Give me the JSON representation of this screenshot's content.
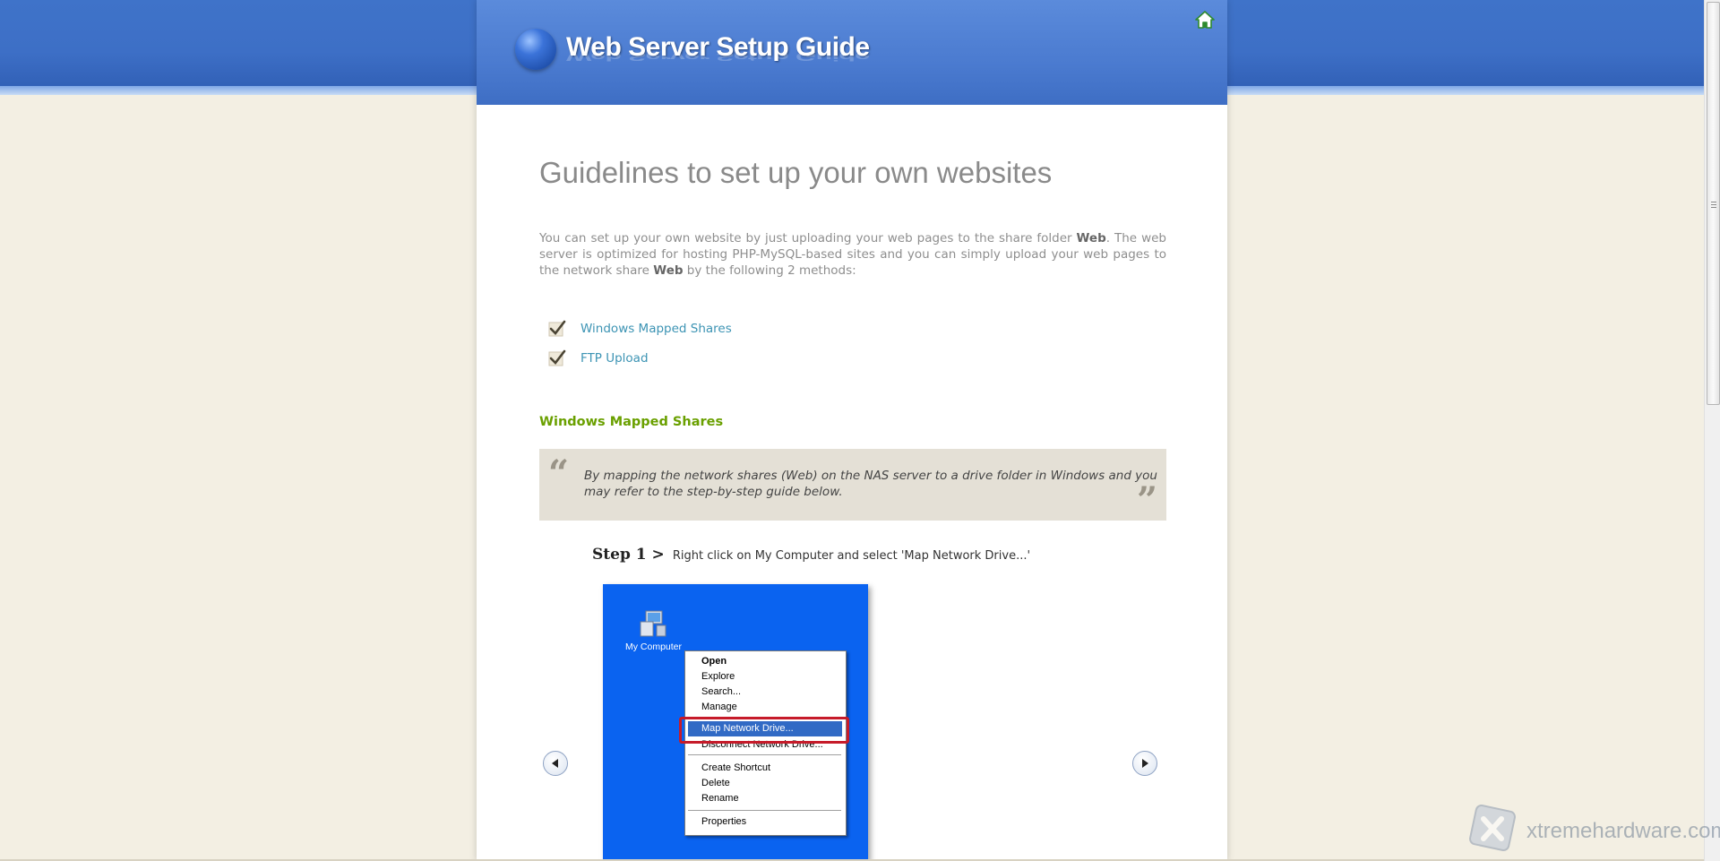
{
  "header": {
    "site_title": "Web Server Setup Guide",
    "home_icon": "home-icon"
  },
  "main": {
    "page_title": "Guidelines to set up your own websites",
    "intro": {
      "part1": "You can set up your own website by just uploading your web pages to the share folder ",
      "bold1": "Web",
      "part2": ". The web server is optimized for hosting PHP-MySQL-based sites and you can simply upload your web pages to the network share ",
      "bold2": "Web",
      "part3": " by the following 2 methods:"
    },
    "methods": [
      {
        "label": "Windows Mapped Shares",
        "icon": "checkmark-icon"
      },
      {
        "label": "FTP Upload",
        "icon": "checkmark-icon"
      }
    ],
    "section_title": "Windows Mapped Shares",
    "quote": "By mapping the network shares (Web) on the NAS server to a drive folder in Windows and you may refer to the step-by-step guide below.",
    "step": {
      "label": "Step 1 >",
      "text": "Right click on My Computer and select 'Map Network Drive...'"
    },
    "screenshot": {
      "desktop_icon_label": "My Computer",
      "menu_items": [
        "Open",
        "Explore",
        "Search...",
        "Manage",
        "Map Network Drive...",
        "Disconnect Network Drive...",
        "Create Shortcut",
        "Delete",
        "Rename",
        "Properties"
      ],
      "highlighted_item": "Map Network Drive..."
    },
    "carousel": {
      "prev_icon": "left-arrow-icon",
      "next_icon": "right-arrow-icon"
    }
  },
  "watermark": {
    "text": "xtremehardware.com"
  },
  "colors": {
    "header_blue": "#3d6fc6",
    "page_bg": "#f3efe3",
    "link": "#3d94b4",
    "section_green": "#6aa000",
    "highlight": "#316ac5",
    "red_frame": "#c61b2a"
  }
}
